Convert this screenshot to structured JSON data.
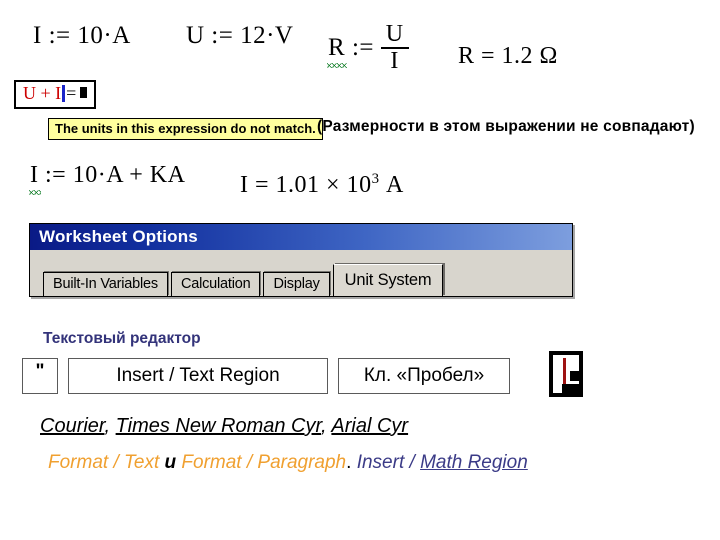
{
  "slide": {
    "formulas": {
      "def_current": "I := 10·A",
      "def_voltage": "U := 12·V",
      "def_resistance_lhs": "R :=",
      "frac_numerator": "U",
      "frac_denominator": "I",
      "result_resistance": "R = 1.2 Ω",
      "bad_units_expr": "I := 10·A + KA",
      "result_current": "I = 1.01 × 10",
      "result_current_exponent": "3",
      "result_current_unit": "A"
    },
    "error_region": {
      "operand_left": "U",
      "operator": "+",
      "operand_right": "I",
      "equals": "=",
      "placeholder": "■"
    },
    "tooltip": {
      "text": "The units in this expression do not match."
    },
    "annotation_ru": "(Размерности в этом выражении не совпадают)",
    "dialog": {
      "title": "Worksheet Options",
      "tabs": [
        {
          "label": "Built-In Variables",
          "active": false
        },
        {
          "label": "Calculation",
          "active": false
        },
        {
          "label": "Display",
          "active": false
        },
        {
          "label": "Unit System",
          "active": true
        }
      ]
    },
    "text_editor": {
      "section_title": "Текстовый редактор",
      "quote_key": "\"",
      "menu_path": "Insert / Text Region",
      "space_key": "Кл. «Пробел»",
      "cursor_icon_name": "text-cursor-icon"
    },
    "fonts_line": {
      "font_1": "Courier",
      "sep_1": ", ",
      "font_2": "Times New Roman Cyr",
      "sep_2": ", ",
      "font_3": "Arial Cyr"
    },
    "menu_line": {
      "part_1": "Format / Text",
      "conjunction": " и ",
      "part_2": "Format / Paragraph",
      "period": ". ",
      "part_3": "Insert / ",
      "part_4": "Math Region"
    },
    "colors": {
      "error_red": "#cc0000",
      "cursor_blue": "#1a25c8",
      "squiggle_green": "#0a7a22",
      "tooltip_yellow": "#ffff9e",
      "title_navy": "#33337a",
      "accent_orange": "#f0a030",
      "link_navy": "#3b3b87",
      "dialog_face": "#d8d5cd"
    }
  }
}
